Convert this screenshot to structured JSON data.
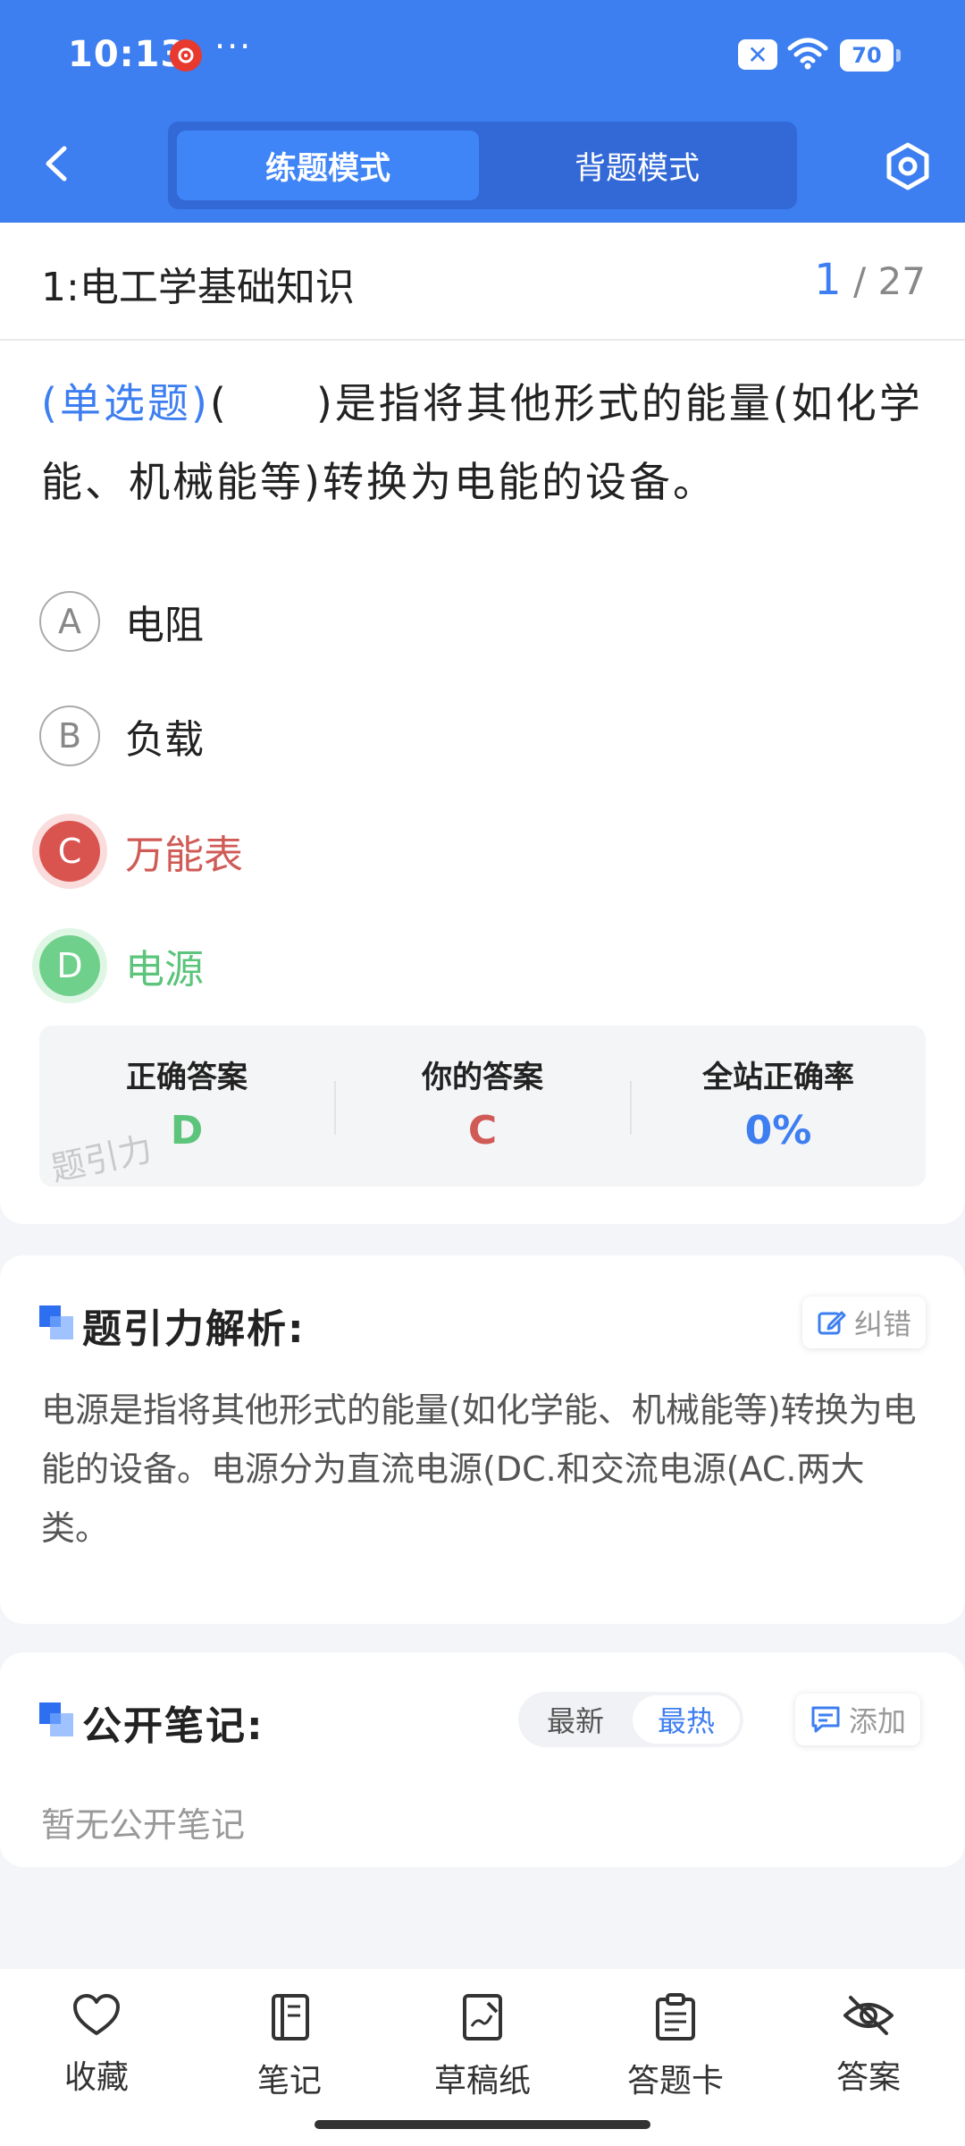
{
  "status_bar": {
    "time": "10:13",
    "more": "···",
    "battery": "70"
  },
  "header": {
    "tabs": [
      {
        "label": "练题模式",
        "active": true
      },
      {
        "label": "背题模式",
        "active": false
      }
    ]
  },
  "question": {
    "chapter": "1:电工学基础知识",
    "index": "1",
    "total": "/ 27",
    "type": "(单选题)",
    "stem": "(　　)是指将其他形式的能量(如化学能、机械能等)转换为电能的设备。",
    "options": [
      {
        "letter": "A",
        "text": "电阻",
        "state": "normal"
      },
      {
        "letter": "B",
        "text": "负载",
        "state": "normal"
      },
      {
        "letter": "C",
        "text": "万能表",
        "state": "wrong"
      },
      {
        "letter": "D",
        "text": "电源",
        "state": "correct"
      }
    ]
  },
  "result": {
    "correct_label": "正确答案",
    "correct_value": "D",
    "yours_label": "你的答案",
    "yours_value": "C",
    "rate_label": "全站正确率",
    "rate_value": "0%",
    "watermark": "题引力"
  },
  "analysis": {
    "title": "题引力解析:",
    "report_label": "纠错",
    "text": "电源是指将其他形式的能量(如化学能、机械能等)转换为电能的设备。电源分为直流电源(DC.和交流电源(AC.两大类。"
  },
  "notes": {
    "title": "公开笔记:",
    "sort_latest": "最新",
    "sort_hot": "最热",
    "add_label": "添加",
    "empty": "暂无公开笔记"
  },
  "bottom_nav": [
    {
      "label": "收藏",
      "icon": "heart-icon"
    },
    {
      "label": "笔记",
      "icon": "notebook-icon"
    },
    {
      "label": "草稿纸",
      "icon": "draft-icon"
    },
    {
      "label": "答题卡",
      "icon": "answer-card-icon"
    },
    {
      "label": "答案",
      "icon": "eye-off-icon"
    }
  ],
  "colors": {
    "primary": "#3d7ef0",
    "wrong": "#d9534f",
    "correct": "#6fd08b"
  }
}
